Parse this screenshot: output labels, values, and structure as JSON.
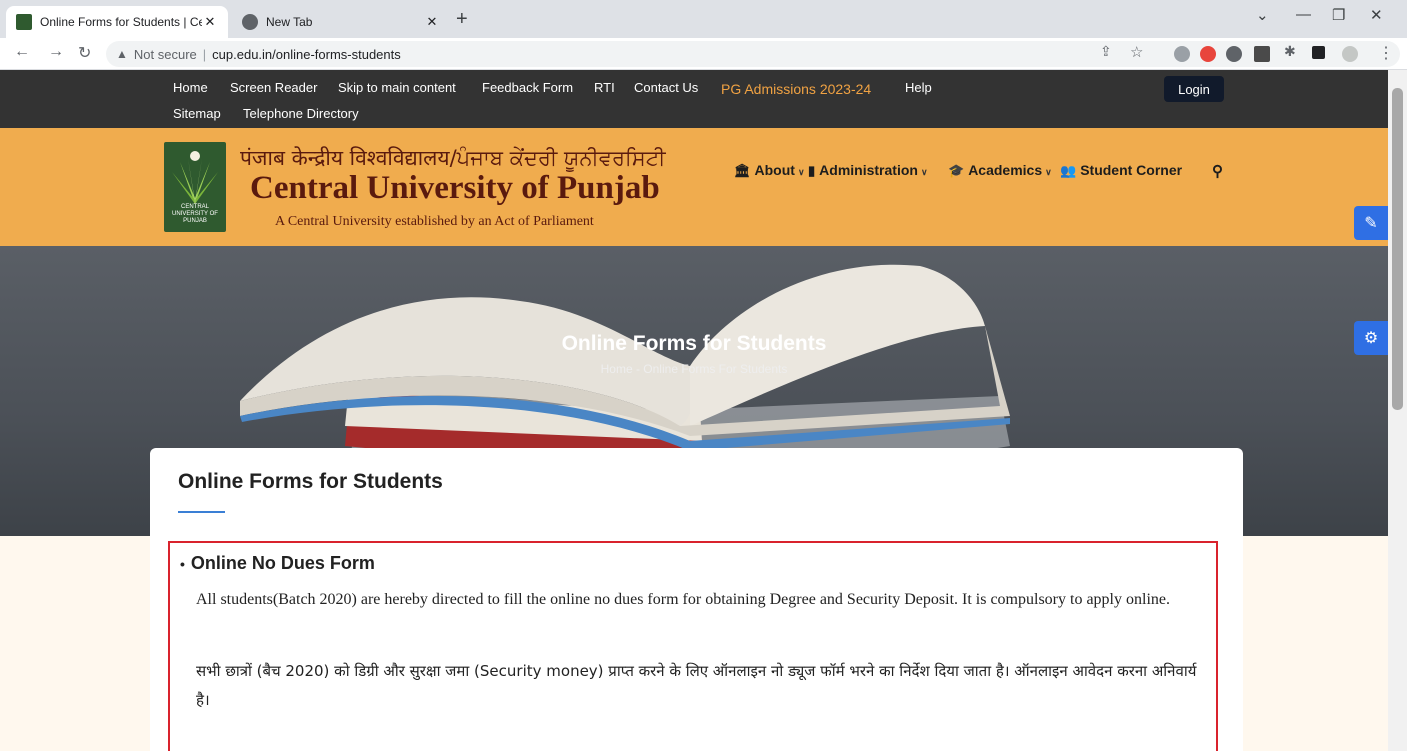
{
  "browser": {
    "tabs": [
      {
        "title": "Online Forms for Students | Centr",
        "favicon": "cup-favicon"
      },
      {
        "title": "New Tab",
        "favicon": "chrome-icon"
      }
    ],
    "url_security": "Not secure",
    "url": "cup.edu.in/online-forms-students"
  },
  "topnav": {
    "links": [
      "Home",
      "Screen Reader",
      "Skip to main content",
      "Feedback Form",
      "RTI",
      "Contact Us",
      "PG Admissions 2023-24",
      "Help",
      "Sitemap",
      "Telephone Directory"
    ],
    "login_label": "Login"
  },
  "brand": {
    "hindi_name": "पंजाब केन्द्रीय विश्वविद्यालय/ਪੰਜਾਬ ਕੇਂਦਰੀ ਯੂਨੀਵਰਸਿਟੀ",
    "english_name": "Central University of Punjab",
    "tagline": "A Central University established by an Act of Parliament",
    "logo_text": "CENTRAL UNIVERSITY OF PUNJAB"
  },
  "mainnav": {
    "items": [
      {
        "label": "About",
        "icon": "bank-icon"
      },
      {
        "label": "Administration",
        "icon": "building-icon"
      },
      {
        "label": "Academics",
        "icon": "graduation-cap-icon"
      },
      {
        "label": "Student Corner",
        "icon": "users-icon"
      }
    ]
  },
  "hero": {
    "title": "Online Forms for Students",
    "breadcrumb": "Home - Online Forms For Students"
  },
  "content": {
    "heading": "Online Forms for Students",
    "item_title": "Online No Dues Form",
    "para_en": "All students(Batch 2020) are hereby directed to fill the online no dues form for obtaining Degree and Security Deposit. It is compulsory to apply online.",
    "para_hi": "सभी छात्रों (बैच 2020) को डिग्री और सुरक्षा जमा (Security money) प्राप्त करने के लिए ऑनलाइन नो ड्यूज फॉर्म भरने का निर्देश दिया जाता है। ऑनलाइन आवेदन करना अनिवार्य है।"
  },
  "colors": {
    "topnav_bg": "#333333",
    "brand_bg": "#f0ac4e",
    "pg_link": "#f0a243",
    "highlight_border": "#d9232d",
    "float_btn": "#2f6fe4"
  }
}
